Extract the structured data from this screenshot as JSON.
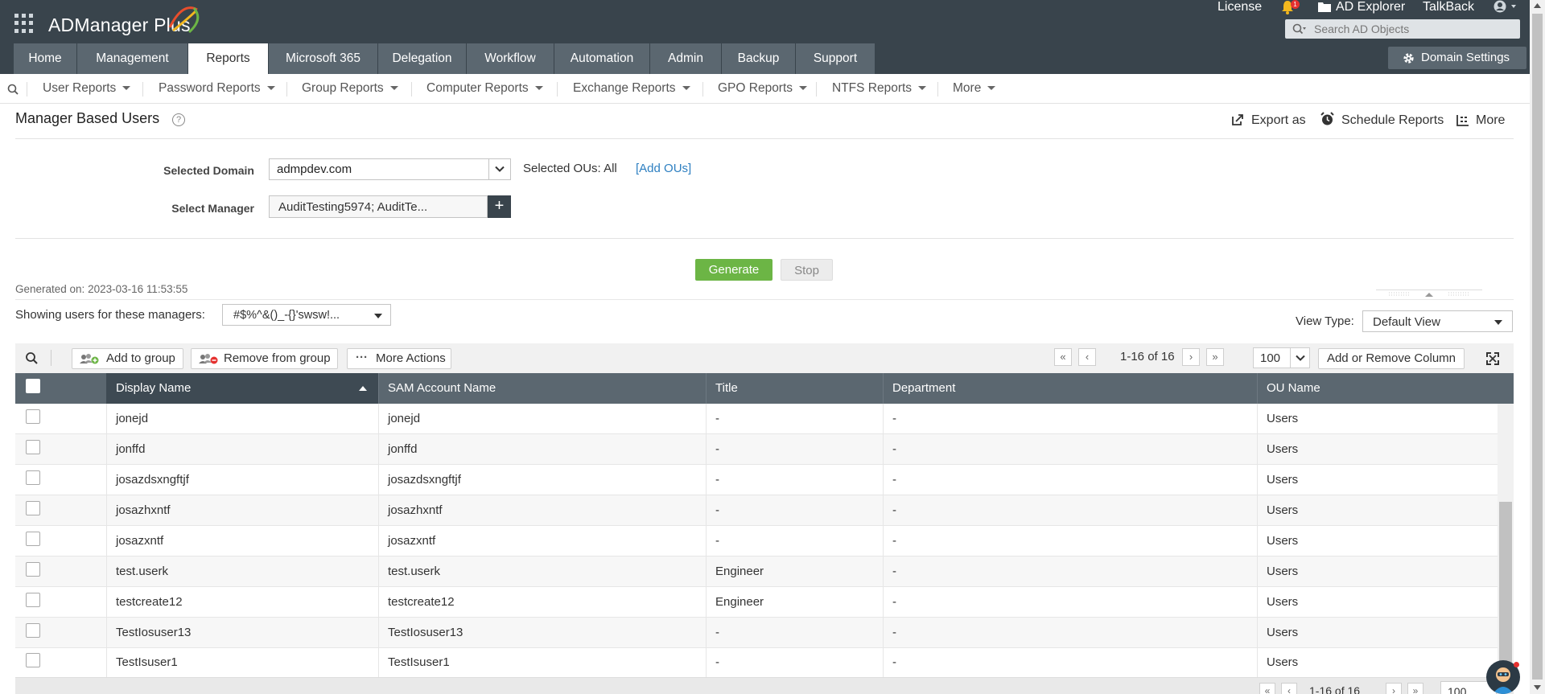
{
  "app": {
    "title": "ADManager Plus",
    "brand_color": "#39444c",
    "accent_green": "#6cb545"
  },
  "top_links": {
    "license": "License",
    "notifications_count": "1",
    "ad_explorer": "AD Explorer",
    "talkback": "TalkBack"
  },
  "search": {
    "placeholder": "Search AD Objects"
  },
  "nav": {
    "tabs": [
      {
        "label": "Home"
      },
      {
        "label": "Management"
      },
      {
        "label": "Reports",
        "active": true
      },
      {
        "label": "Microsoft 365"
      },
      {
        "label": "Delegation"
      },
      {
        "label": "Workflow"
      },
      {
        "label": "Automation"
      },
      {
        "label": "Admin"
      },
      {
        "label": "Backup"
      },
      {
        "label": "Support"
      }
    ],
    "domain_settings": "Domain Settings"
  },
  "subnav": {
    "items": [
      {
        "label": "User Reports"
      },
      {
        "label": "Password Reports"
      },
      {
        "label": "Group Reports"
      },
      {
        "label": "Computer Reports"
      },
      {
        "label": "Exchange Reports"
      },
      {
        "label": "GPO Reports"
      },
      {
        "label": "NTFS Reports"
      },
      {
        "label": "More"
      }
    ]
  },
  "report": {
    "title": "Manager Based Users",
    "export_as": "Export as",
    "schedule_reports": "Schedule Reports",
    "more": "More",
    "selected_domain_label": "Selected Domain",
    "selected_domain_value": "admpdev.com",
    "selected_ous_label": "Selected OUs:",
    "selected_ous_value": "All",
    "add_ous": "[Add OUs]",
    "select_manager_label": "Select Manager",
    "select_manager_value": "AuditTesting5974; AuditTe...",
    "generate": "Generate",
    "stop": "Stop",
    "generated_on": "Generated on: 2023-03-16 11:53:55",
    "showing_label": "Showing users for these managers:",
    "showing_value": "#$%^&()_-{}'swsw!...",
    "view_type_label": "View Type:",
    "view_type_value": "Default View"
  },
  "toolbar": {
    "add_to_group": "Add to group",
    "remove_from_group": "Remove from group",
    "more_actions": "More Actions",
    "page_info": "1-16 of 16",
    "page_size": "100",
    "add_remove_column": "Add or Remove Column"
  },
  "table": {
    "columns": [
      "Display Name",
      "SAM Account Name",
      "Title",
      "Department",
      "OU Name"
    ],
    "sorted_column": "Display Name",
    "rows": [
      {
        "display_name": "jonejd",
        "sam": "jonejd",
        "title": "-",
        "department": "-",
        "ou": "Users"
      },
      {
        "display_name": "jonffd",
        "sam": "jonffd",
        "title": "-",
        "department": "-",
        "ou": "Users"
      },
      {
        "display_name": "josazdsxngftjf",
        "sam": "josazdsxngftjf",
        "title": "-",
        "department": "-",
        "ou": "Users"
      },
      {
        "display_name": "josazhxntf",
        "sam": "josazhxntf",
        "title": "-",
        "department": "-",
        "ou": "Users"
      },
      {
        "display_name": "josazxntf",
        "sam": "josazxntf",
        "title": "-",
        "department": "-",
        "ou": "Users"
      },
      {
        "display_name": "test.userk",
        "sam": "test.userk",
        "title": "Engineer",
        "department": "-",
        "ou": "Users"
      },
      {
        "display_name": "testcreate12",
        "sam": "testcreate12",
        "title": "Engineer",
        "department": "-",
        "ou": "Users"
      },
      {
        "display_name": "TestIosuser13",
        "sam": "TestIosuser13",
        "title": "-",
        "department": "-",
        "ou": "Users"
      },
      {
        "display_name": "TestIsuser1",
        "sam": "TestIsuser1",
        "title": "-",
        "department": "-",
        "ou": "Users"
      }
    ]
  },
  "footer": {
    "page_info": "1-16 of 16",
    "page_size": "100"
  }
}
